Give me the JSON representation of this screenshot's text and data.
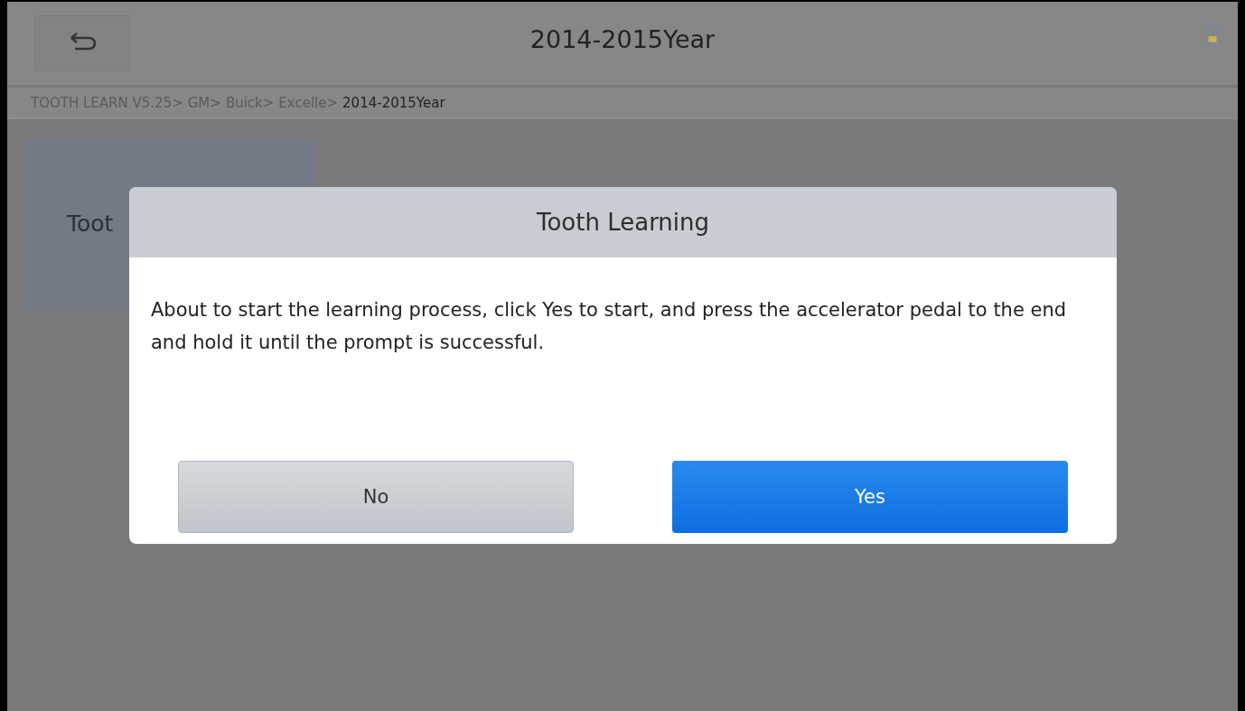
{
  "header": {
    "title": "2014-2015Year"
  },
  "breadcrumb": [
    {
      "label": "TOOTH LEARN V5.25>",
      "selected": false
    },
    {
      "label": "GM>",
      "selected": false
    },
    {
      "label": "Buick>",
      "selected": false
    },
    {
      "label": "Excelle>",
      "selected": false
    },
    {
      "label": "2014-2015Year",
      "selected": true
    }
  ],
  "tiles": [
    {
      "label": "Toot"
    }
  ],
  "dialog": {
    "title": "Tooth Learning",
    "message": "About to start the learning process, click Yes to start, and press the accelerator pedal to the end and hold it until the prompt is successful.",
    "buttons": [
      {
        "label": "No",
        "kind": "secondary"
      },
      {
        "label": "Yes",
        "kind": "primary"
      }
    ]
  }
}
